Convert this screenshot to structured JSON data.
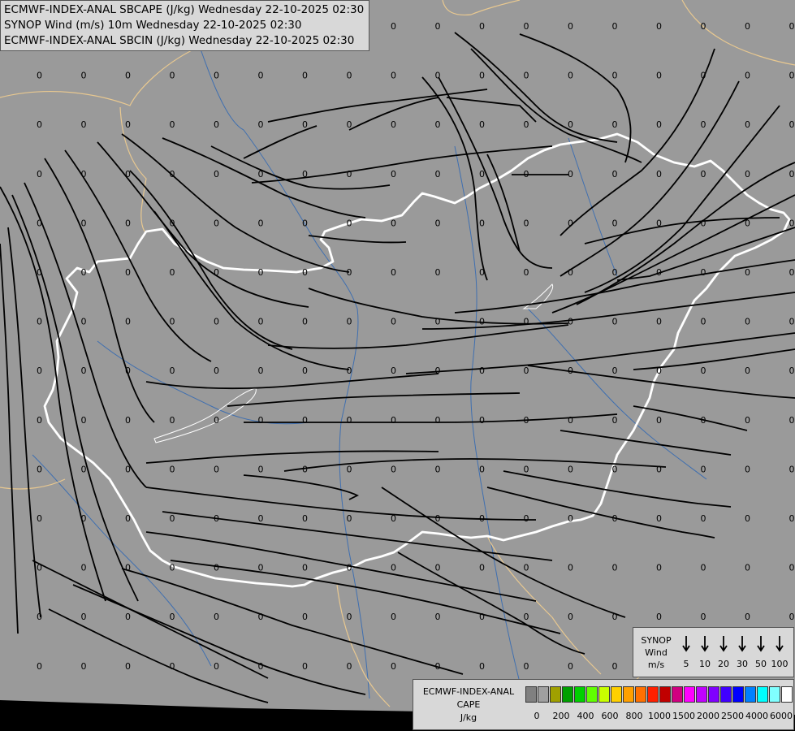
{
  "header": {
    "lines": [
      "ECMWF-INDEX-ANAL SBCAPE (J/kg) Wednesday 22-10-2025 02:30",
      "SYNOP Wind (m/s) 10m Wednesday 22-10-2025 02:30",
      "ECMWF-INDEX-ANAL SBCIN (J/kg) Wednesday 22-10-2025 02:30"
    ]
  },
  "map": {
    "grid_value": "0",
    "background_color": "#9a9a9a",
    "border_color": "#ffffff",
    "neighbor_border_color": "#e8c890",
    "river_color": "#3f6fb0",
    "streamline_color": "#000000"
  },
  "wind_legend": {
    "title": [
      "SYNOP",
      "Wind",
      "m/s"
    ],
    "values": [
      "5",
      "10",
      "20",
      "30",
      "50",
      "100"
    ]
  },
  "cape_legend": {
    "title": [
      "ECMWF-INDEX-ANAL",
      "CAPE",
      "J/kg"
    ],
    "colors": [
      "#808080",
      "#a0a0a0",
      "#a0a000",
      "#00a000",
      "#00d000",
      "#60ff00",
      "#c8ff00",
      "#ffd000",
      "#ffa000",
      "#ff7000",
      "#ff2000",
      "#c00000",
      "#d00080",
      "#ff00ff",
      "#c000ff",
      "#8000ff",
      "#4000ff",
      "#0000ff",
      "#0080ff",
      "#00ffff",
      "#80ffff",
      "#ffffff"
    ],
    "values": [
      "0",
      "200",
      "400",
      "600",
      "800",
      "1000",
      "1500",
      "2000",
      "2500",
      "4000",
      "6000"
    ]
  }
}
